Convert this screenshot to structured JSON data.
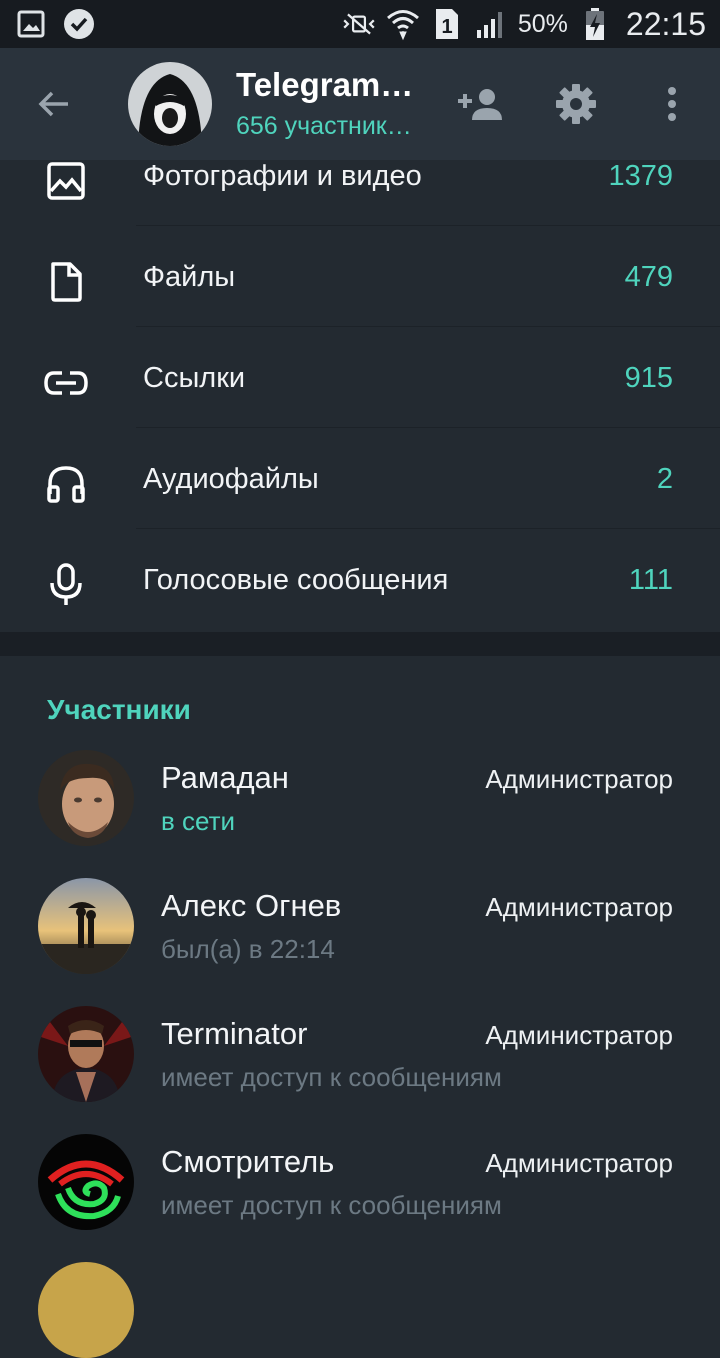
{
  "status_bar": {
    "icons": [
      "gallery-icon",
      "check-circle-icon",
      "vibrate-off-icon",
      "wifi-icon",
      "sim-1-icon",
      "signal-icon",
      "battery-charging-icon"
    ],
    "sim_slot": "1",
    "battery": "50%",
    "time": "22:15"
  },
  "header": {
    "title": "Telegram…",
    "subtitle": "656 участник…",
    "icons": [
      "back-arrow-icon",
      "add-member-icon",
      "settings-icon",
      "more-vert-icon"
    ]
  },
  "media": [
    {
      "label": "Фотографии и видео",
      "count": "1379",
      "icon": "photo-icon"
    },
    {
      "label": "Файлы",
      "count": "479",
      "icon": "file-icon"
    },
    {
      "label": "Ссылки",
      "count": "915",
      "icon": "link-icon"
    },
    {
      "label": "Аудиофайлы",
      "count": "2",
      "icon": "headphones-icon"
    },
    {
      "label": "Голосовые сообщения",
      "count": "111",
      "icon": "mic-icon"
    }
  ],
  "members_section": {
    "title": "Участники",
    "members": [
      {
        "name": "Рамадан",
        "status": "в сети",
        "role": "Администратор"
      },
      {
        "name": "Алекс Огнев",
        "status": "был(а) в 22:14",
        "role": "Администратор"
      },
      {
        "name": "Terminator",
        "status": "имеет доступ к сообщениям",
        "role": "Администратор"
      },
      {
        "name": "Смотритель",
        "status": "имеет доступ к сообщениям",
        "role": "Администратор"
      }
    ]
  },
  "colors": {
    "accent": "#4fd4bd",
    "background": "#232a31",
    "header": "#2a333c",
    "status_bar": "#171b20"
  }
}
